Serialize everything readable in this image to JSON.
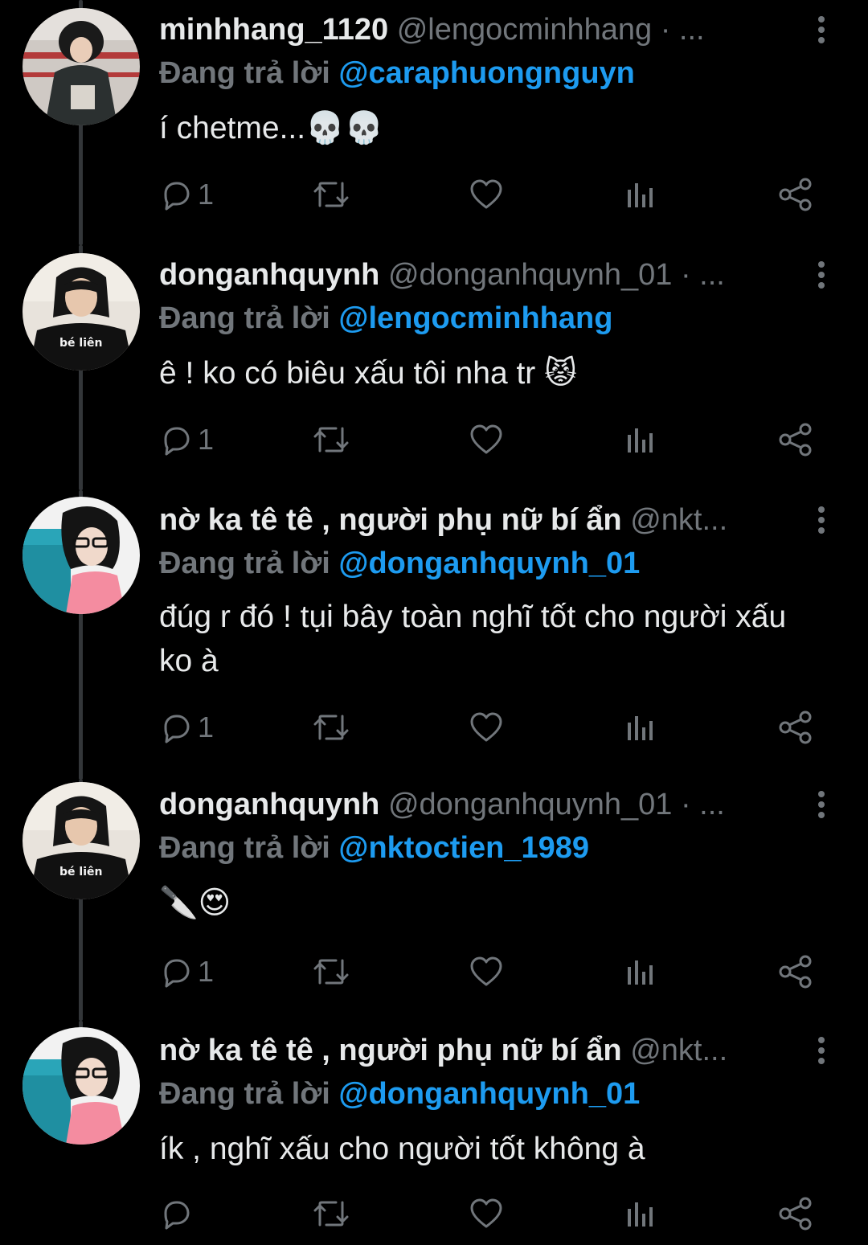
{
  "replying_label": "Đang trả lời",
  "colors": {
    "background": "#000000",
    "text_primary": "#e7e9ea",
    "text_secondary": "#71767b",
    "accent": "#1d9bf0",
    "thread_line": "#333639"
  },
  "tweets": [
    {
      "display_name": "minhhang_1120",
      "handle_meta": "@lengocminhhang · ...",
      "reply_to": "@caraphuongnguyn",
      "text": "í chetme...💀💀",
      "reply_count": "1",
      "avatar_icon": "avatar-photo"
    },
    {
      "display_name": "donganhquynh",
      "handle_meta": "@donganhquynh_01 · ...",
      "reply_to": "@lengocminhhang",
      "text": "ê ! ko có biêu xấu tôi nha tr 😾",
      "reply_count": "1",
      "avatar_icon": "avatar-photo",
      "avatar_shirt_text": "bé liên"
    },
    {
      "display_name": "nờ ka tê tê , người phụ nữ bí ẩn",
      "handle_meta": "@nkt...",
      "reply_to": "@donganhquynh_01",
      "text": "đúg r đó ! tụi bây toàn nghĩ tốt cho người xấu ko à",
      "reply_count": "1",
      "avatar_icon": "avatar-photo"
    },
    {
      "display_name": "donganhquynh",
      "handle_meta": "@donganhquynh_01 · ...",
      "reply_to": "@nktoctien_1989",
      "text": "🔪😍",
      "reply_count": "1",
      "avatar_icon": "avatar-photo",
      "avatar_shirt_text": "bé liên"
    },
    {
      "display_name": "nờ ka tê tê , người phụ nữ bí ẩn",
      "handle_meta": "@nkt...",
      "reply_to": "@donganhquynh_01",
      "text": "ík , nghĩ xấu cho người tốt không à",
      "reply_count": "",
      "avatar_icon": "avatar-photo"
    }
  ],
  "action_icons": [
    "reply-icon",
    "retweet-icon",
    "like-icon",
    "views-icon",
    "share-icon"
  ]
}
